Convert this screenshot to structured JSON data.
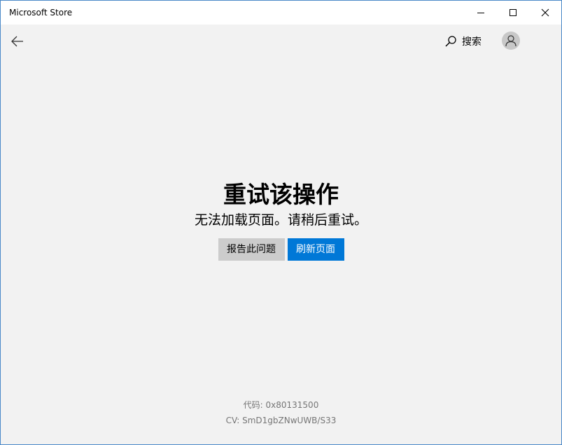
{
  "window": {
    "title": "Microsoft Store",
    "minimize_icon": "minimize-icon",
    "maximize_icon": "maximize-icon",
    "close_icon": "close-icon"
  },
  "nav": {
    "back_icon": "back-arrow-icon",
    "search_label": "搜索",
    "search_icon": "search-icon",
    "account_icon": "person-icon"
  },
  "error": {
    "title": "重试该操作",
    "message": "无法加载页面。请稍后重试。",
    "report_button": "报告此问题",
    "refresh_button": "刷新页面"
  },
  "footer": {
    "code": "代码: 0x80131500",
    "cv": "CV: SmD1gbZNwUWB/S33"
  },
  "colors": {
    "accent": "#0078d7",
    "secondary_button": "#cccccc",
    "background": "#f2f2f2"
  }
}
